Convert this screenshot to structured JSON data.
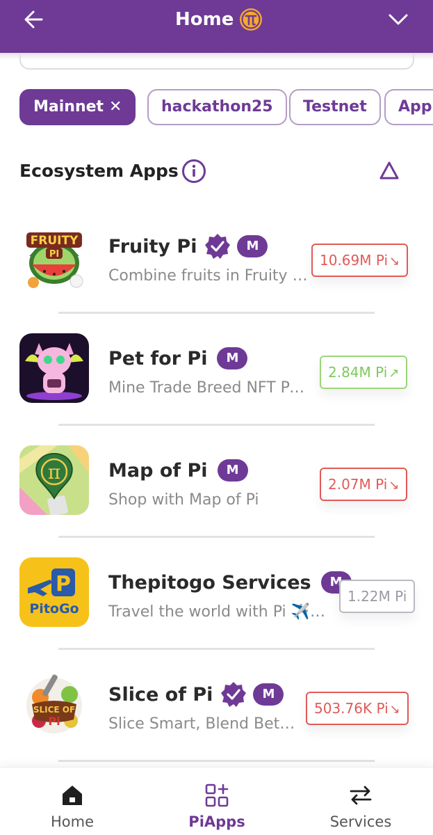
{
  "header": {
    "title": "Home",
    "back_icon": "arrow-left-icon",
    "logo_icon": "pi-logo-icon",
    "menu_icon": "chevron-down-icon",
    "background_color": "#6e3a96"
  },
  "filters": [
    {
      "label": "Mainnet",
      "active": true,
      "close_icon": "close-icon"
    },
    {
      "label": "hackathon25",
      "active": false
    },
    {
      "label": "Testnet",
      "active": false
    },
    {
      "label": "App",
      "active": false
    }
  ],
  "section": {
    "title": "Ecosystem Apps",
    "info_icon": "info-icon",
    "sort_icon": "triangle-up-icon"
  },
  "apps": [
    {
      "name": "Fruity Pi",
      "verified": true,
      "badge": "M",
      "description": "Combine fruits in Fruity Pi and earn rewards",
      "stat": "10.69M Pi",
      "trend": "down"
    },
    {
      "name": "Pet for Pi",
      "verified": false,
      "badge": "M",
      "description": "Mine Trade Breed NFT Pets",
      "stat": "2.84M Pi",
      "trend": "up"
    },
    {
      "name": "Map of Pi",
      "verified": false,
      "badge": "M",
      "description": "Shop with Map of Pi",
      "stat": "2.07M Pi",
      "trend": "down"
    },
    {
      "name": "Thepitogo Services",
      "verified": false,
      "badge": "M",
      "description": "Travel the world with Pi ✈️ and more",
      "stat": "1.22M Pi",
      "trend": "flat"
    },
    {
      "name": "Slice of Pi",
      "verified": true,
      "badge": "M",
      "description": "Slice Smart, Blend Better",
      "stat": "503.76K Pi",
      "trend": "down"
    }
  ],
  "icon_texts": {
    "fruity": "FRUITY",
    "fruity_pi": "PI",
    "pitogo": "PitoGo",
    "slice": "SLICE OF",
    "slice_pi": "Pi"
  },
  "bottom_nav": [
    {
      "label": "Home",
      "icon": "home-icon",
      "active": false
    },
    {
      "label": "PiApps",
      "icon": "apps-grid-icon",
      "active": true
    },
    {
      "label": "Services",
      "icon": "swap-arrows-icon",
      "active": false
    }
  ],
  "colors": {
    "brand": "#6e3a96",
    "down": "#e05a57",
    "up": "#7cc95a",
    "neutral": "#9a9aa3"
  }
}
